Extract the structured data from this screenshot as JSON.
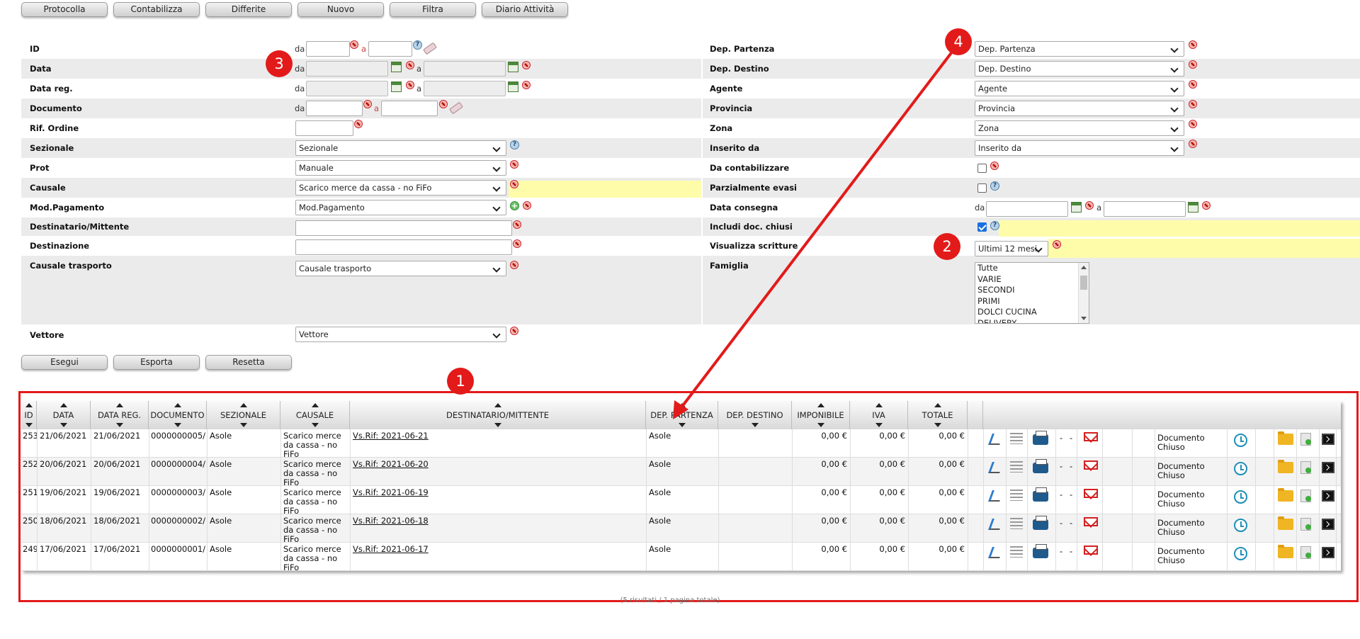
{
  "toolbar": [
    "Protocolla",
    "Contabilizza",
    "Differite",
    "Nuovo",
    "Filtra",
    "Diario Attività"
  ],
  "filters": {
    "left": {
      "id_label": "ID",
      "data_label": "Data",
      "data_reg_label": "Data reg.",
      "documento_label": "Documento",
      "rif_ordine_label": "Rif. Ordine",
      "sezionale_label": "Sezionale",
      "prot_label": "Prot",
      "causale_label": "Causale",
      "mod_pag_label": "Mod.Pagamento",
      "destinatario_label": "Destinatario/Mittente",
      "destinazione_label": "Destinazione",
      "causale_trasporto_label": "Causale trasporto",
      "vettore_label": "Vettore",
      "sezionale_value": "Sezionale",
      "prot_value": "Manuale",
      "causale_value": "Scarico merce da cassa - no FiFo",
      "mod_pag_value": "Mod.Pagamento",
      "causale_trasporto_value": "Causale trasporto",
      "vettore_value": "Vettore"
    },
    "right": {
      "dep_partenza_label": "Dep. Partenza",
      "dep_destino_label": "Dep. Destino",
      "agente_label": "Agente",
      "provincia_label": "Provincia",
      "zona_label": "Zona",
      "inserito_da_label": "Inserito da",
      "da_contabilizzare_label": "Da contabilizzare",
      "parzialmente_evasi_label": "Parzialmente evasi",
      "data_consegna_label": "Data consegna",
      "includi_chiusi_label": "Includi doc. chiusi",
      "visualizza_label": "Visualizza scritture",
      "famiglia_label": "Famiglia",
      "dep_partenza_value": "Dep. Partenza",
      "dep_destino_value": "Dep. Destino",
      "agente_value": "Agente",
      "provincia_value": "Provincia",
      "zona_value": "Zona",
      "inserito_da_value": "Inserito da",
      "visualizza_value": "Ultimi 12 mesi",
      "famiglia_options": [
        "Tutte",
        "VARIE",
        "SECONDI",
        "PRIMI",
        "DOLCI CUCINA",
        "DELIVERY"
      ]
    },
    "range_da": "da",
    "range_a": "a"
  },
  "actions": [
    "Esegui",
    "Esporta",
    "Resetta"
  ],
  "callouts": [
    "1",
    "2",
    "3",
    "4"
  ],
  "table": {
    "columns": [
      "ID",
      "DATA",
      "DATA REG.",
      "DOCUMENTO",
      "SEZIONALE",
      "CAUSALE",
      "DESTINATARIO/MITTENTE",
      "DEP. PARTENZA",
      "DEP. DESTINO",
      "IMPONIBILE",
      "IVA",
      "TOTALE"
    ],
    "rows": [
      {
        "id": "253",
        "data": "21/06/2021",
        "data_reg": "21/06/2021",
        "documento": "0000000005/",
        "sezionale": "Asole",
        "causale": "Scarico merce da cassa - no FiFo",
        "destinatario": "Vs.Rif: 2021-06-21",
        "dep_partenza": "Asole",
        "dep_destino": "",
        "imponibile": "0,00 €",
        "iva": "0,00 €",
        "totale": "0,00 €",
        "dash1": "-",
        "dash2": "-",
        "stato": "Documento Chiuso"
      },
      {
        "id": "252",
        "data": "20/06/2021",
        "data_reg": "20/06/2021",
        "documento": "0000000004/",
        "sezionale": "Asole",
        "causale": "Scarico merce da cassa - no FiFo",
        "destinatario": "Vs.Rif: 2021-06-20",
        "dep_partenza": "Asole",
        "dep_destino": "",
        "imponibile": "0,00 €",
        "iva": "0,00 €",
        "totale": "0,00 €",
        "dash1": "-",
        "dash2": "-",
        "stato": "Documento Chiuso"
      },
      {
        "id": "251",
        "data": "19/06/2021",
        "data_reg": "19/06/2021",
        "documento": "0000000003/",
        "sezionale": "Asole",
        "causale": "Scarico merce da cassa - no FiFo",
        "destinatario": "Vs.Rif: 2021-06-19",
        "dep_partenza": "Asole",
        "dep_destino": "",
        "imponibile": "0,00 €",
        "iva": "0,00 €",
        "totale": "0,00 €",
        "dash1": "-",
        "dash2": "-",
        "stato": "Documento Chiuso"
      },
      {
        "id": "250",
        "data": "18/06/2021",
        "data_reg": "18/06/2021",
        "documento": "0000000002/",
        "sezionale": "Asole",
        "causale": "Scarico merce da cassa - no FiFo",
        "destinatario": "Vs.Rif: 2021-06-18",
        "dep_partenza": "Asole",
        "dep_destino": "",
        "imponibile": "0,00 €",
        "iva": "0,00 €",
        "totale": "0,00 €",
        "dash1": "-",
        "dash2": "-",
        "stato": "Documento Chiuso"
      },
      {
        "id": "249",
        "data": "17/06/2021",
        "data_reg": "17/06/2021",
        "documento": "0000000001/",
        "sezionale": "Asole",
        "causale": "Scarico merce da cassa - no FiFo",
        "destinatario": "Vs.Rif: 2021-06-17",
        "dep_partenza": "Asole",
        "dep_destino": "",
        "imponibile": "0,00 €",
        "iva": "0,00 €",
        "totale": "0,00 €",
        "dash1": "-",
        "dash2": "-",
        "stato": "Documento Chiuso"
      }
    ],
    "icons": [
      "edit-icon",
      "reorder-icon",
      "print-icon",
      "email-icon",
      "history-icon",
      "folder-icon",
      "export-doc-icon",
      "terminal-icon"
    ],
    "footer": "(5 risultati / 1 pagina totale)"
  },
  "colors": {
    "callout": "#e31a1a",
    "highlight": "#fefca8",
    "row_stripe": "#ebebeb"
  }
}
